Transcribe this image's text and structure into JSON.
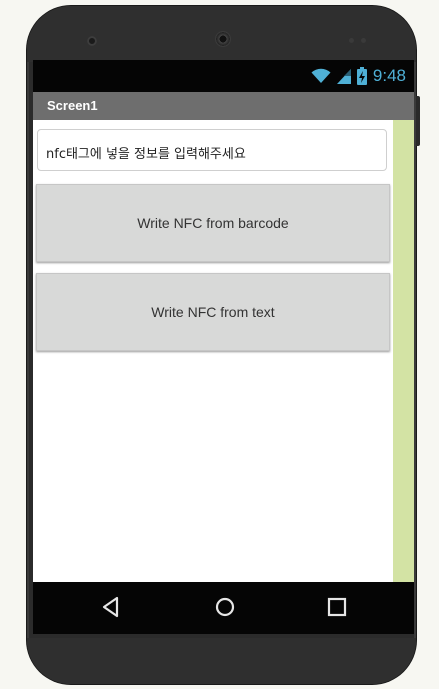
{
  "status_bar": {
    "time": "9:48",
    "icons": [
      "wifi-icon",
      "signal-icon",
      "battery-charging-icon"
    ]
  },
  "title_bar": {
    "title": "Screen1"
  },
  "main": {
    "text_input": {
      "value": "nfc태그에 넣을 정보를 입력해주세요"
    },
    "buttons": [
      {
        "label": "Write NFC from barcode"
      },
      {
        "label": "Write NFC from text"
      }
    ]
  },
  "nav_bar": {
    "icons": [
      "back-icon",
      "home-icon",
      "recents-icon"
    ]
  },
  "colors": {
    "status_icon": "#4fb0d6",
    "title_bar": "#6e6e6e",
    "right_strip": "#d3e3a4",
    "button_bg": "#d8d9d8"
  }
}
